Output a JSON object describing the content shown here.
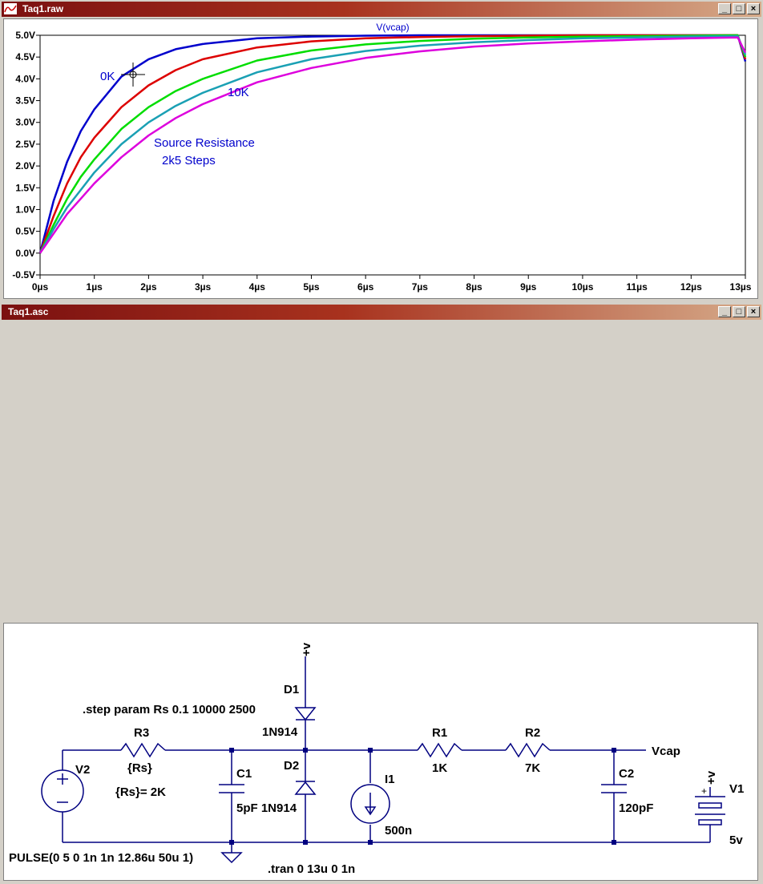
{
  "waveform_window": {
    "title": "Taq1.raw",
    "trace_label": "V(vcap)",
    "annotations": {
      "zero_k": "0K",
      "ten_k": "10K",
      "source_resistance": "Source Resistance",
      "steps": "2k5 Steps"
    }
  },
  "schematic_window": {
    "title": "Taq1.asc",
    "components": {
      "supply_top": "+v",
      "d1_name": "D1",
      "d1_model": "1N914",
      "step_directive": ".step param Rs 0.1 10000 2500",
      "r3_name": "R3",
      "r3_value": "{Rs}",
      "rs_param": "{Rs}= 2K",
      "v2_name": "V2",
      "v2_value": "PULSE(0 5 0 1n 1n 12.86u 50u 1)",
      "c1_name": "C1",
      "c1_value": "5pF 1N914",
      "d2_name": "D2",
      "i1_name": "I1",
      "i1_value": "500n",
      "r1_name": "R1",
      "r1_value": "1K",
      "r2_name": "R2",
      "r2_value": "7K",
      "vcap_label": "Vcap",
      "c2_name": "C2",
      "c2_value": "120pF",
      "v1_supply": "+v",
      "v1_name": "V1",
      "v1_value": "5v",
      "tran_directive": ".tran 0 13u 0 1n"
    }
  },
  "chart_data": {
    "type": "line",
    "title": "V(vcap)",
    "xlabel": "",
    "ylabel": "",
    "x_ticks": [
      "0µs",
      "1µs",
      "2µs",
      "3µs",
      "4µs",
      "5µs",
      "6µs",
      "7µs",
      "8µs",
      "9µs",
      "10µs",
      "11µs",
      "12µs",
      "13µs"
    ],
    "y_ticks": [
      "-0.5V",
      "0.0V",
      "0.5V",
      "1.0V",
      "1.5V",
      "2.0V",
      "2.5V",
      "3.0V",
      "3.5V",
      "4.0V",
      "4.5V",
      "5.0V"
    ],
    "xlim": [
      0,
      13
    ],
    "ylim": [
      -0.5,
      5.0
    ],
    "grid": false,
    "legend": "none",
    "series": [
      {
        "color": "#0000cc",
        "x": [
          0,
          0.25,
          0.5,
          0.75,
          1,
          1.5,
          2,
          2.5,
          3,
          4,
          5,
          6,
          7,
          8,
          9,
          10,
          11,
          12,
          12.86,
          13
        ],
        "y": [
          0,
          1.2,
          2.1,
          2.8,
          3.3,
          4.05,
          4.45,
          4.68,
          4.8,
          4.93,
          4.97,
          4.99,
          5.0,
          5.0,
          5.0,
          5.0,
          5.0,
          5.0,
          5.0,
          4.4
        ]
      },
      {
        "color": "#dd0000",
        "x": [
          0,
          0.25,
          0.5,
          0.75,
          1,
          1.5,
          2,
          2.5,
          3,
          4,
          5,
          6,
          7,
          8,
          9,
          10,
          11,
          12,
          12.86,
          13
        ],
        "y": [
          0,
          0.85,
          1.6,
          2.2,
          2.65,
          3.35,
          3.85,
          4.2,
          4.45,
          4.72,
          4.86,
          4.93,
          4.96,
          4.98,
          4.99,
          5.0,
          5.0,
          5.0,
          5.0,
          4.45
        ]
      },
      {
        "color": "#00dd00",
        "x": [
          0,
          0.25,
          0.5,
          0.75,
          1,
          1.5,
          2,
          2.5,
          3,
          4,
          5,
          6,
          7,
          8,
          9,
          10,
          11,
          12,
          12.86,
          13
        ],
        "y": [
          0,
          0.65,
          1.25,
          1.75,
          2.15,
          2.85,
          3.35,
          3.72,
          4.0,
          4.42,
          4.65,
          4.79,
          4.87,
          4.92,
          4.95,
          4.97,
          4.98,
          4.99,
          5.0,
          4.5
        ]
      },
      {
        "color": "#1aa0b4",
        "x": [
          0,
          0.25,
          0.5,
          0.75,
          1,
          1.5,
          2,
          2.5,
          3,
          4,
          5,
          6,
          7,
          8,
          9,
          10,
          11,
          12,
          12.86,
          13
        ],
        "y": [
          0,
          0.55,
          1.05,
          1.45,
          1.85,
          2.5,
          3.0,
          3.38,
          3.68,
          4.15,
          4.45,
          4.64,
          4.76,
          4.84,
          4.89,
          4.93,
          4.95,
          4.97,
          4.98,
          4.55
        ]
      },
      {
        "color": "#dd00dd",
        "x": [
          0,
          0.25,
          0.5,
          0.75,
          1,
          1.5,
          2,
          2.5,
          3,
          4,
          5,
          6,
          7,
          8,
          9,
          10,
          11,
          12,
          12.86,
          13
        ],
        "y": [
          0,
          0.45,
          0.9,
          1.25,
          1.6,
          2.2,
          2.7,
          3.1,
          3.42,
          3.92,
          4.25,
          4.48,
          4.63,
          4.74,
          4.81,
          4.86,
          4.9,
          4.93,
          4.95,
          4.6
        ]
      }
    ]
  }
}
